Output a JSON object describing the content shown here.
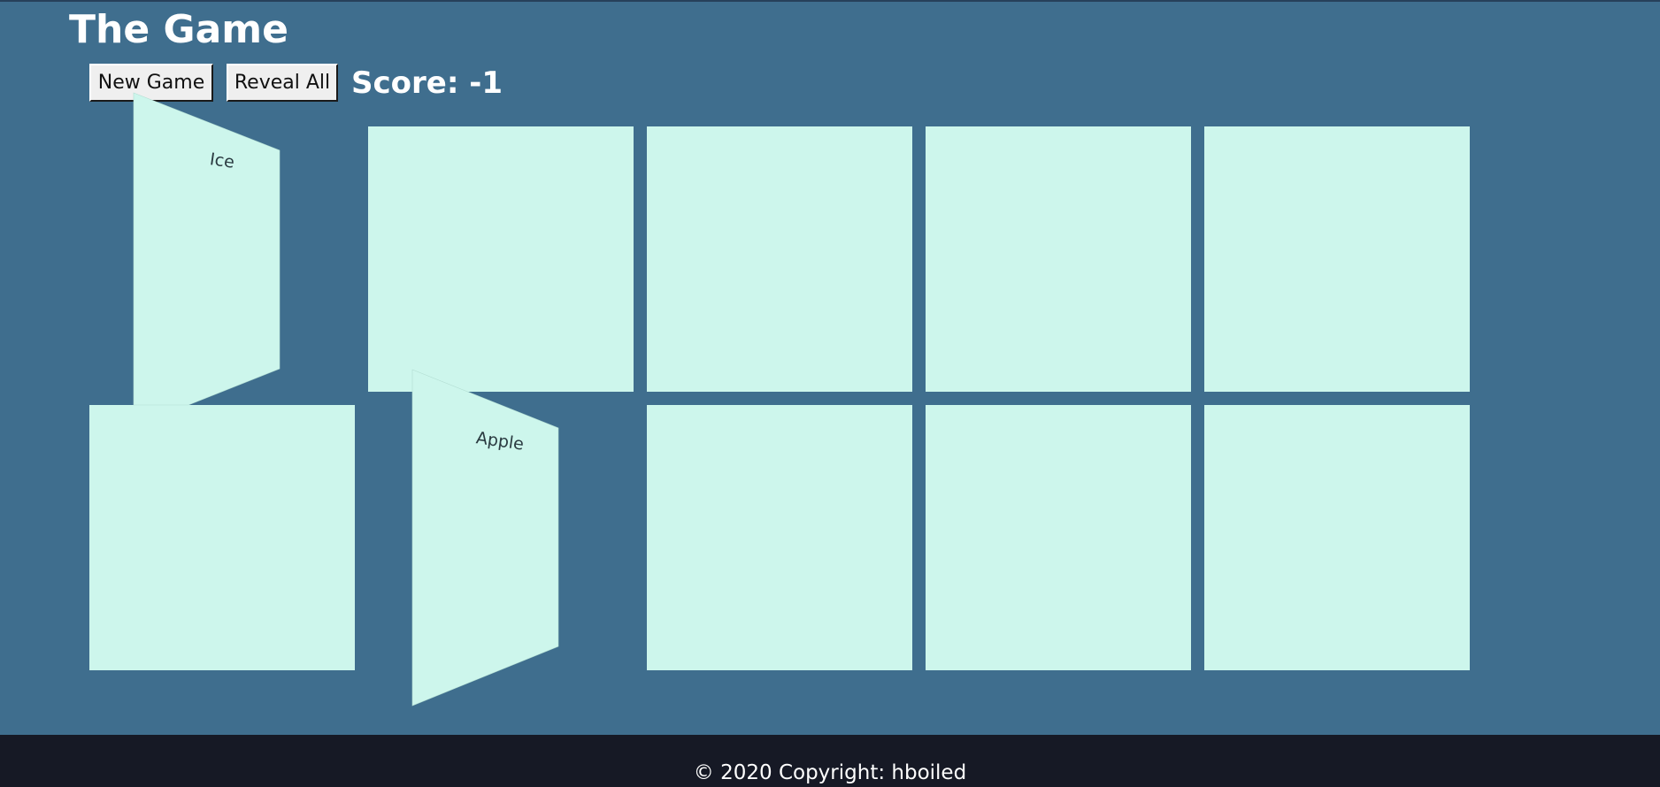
{
  "header": {
    "title": "The Game"
  },
  "controls": {
    "new_game_label": "New Game",
    "reveal_all_label": "Reveal All",
    "score_text": "Score: -1"
  },
  "board": {
    "rows": 2,
    "columns": 5,
    "cards": [
      {
        "row": 0,
        "col": 0,
        "state": "flipping",
        "text": "Ice"
      },
      {
        "row": 0,
        "col": 1,
        "state": "hidden",
        "text": ""
      },
      {
        "row": 0,
        "col": 2,
        "state": "hidden",
        "text": ""
      },
      {
        "row": 0,
        "col": 3,
        "state": "hidden",
        "text": ""
      },
      {
        "row": 0,
        "col": 4,
        "state": "hidden",
        "text": ""
      },
      {
        "row": 1,
        "col": 0,
        "state": "hidden",
        "text": ""
      },
      {
        "row": 1,
        "col": 1,
        "state": "flipping",
        "text": "Apple"
      },
      {
        "row": 1,
        "col": 2,
        "state": "hidden",
        "text": ""
      },
      {
        "row": 1,
        "col": 3,
        "state": "hidden",
        "text": ""
      },
      {
        "row": 1,
        "col": 4,
        "state": "hidden",
        "text": ""
      }
    ]
  },
  "footer": {
    "copyright": "© 2020 Copyright: hboiled"
  },
  "colors": {
    "page_background": "#3f6e8e",
    "card": "#cdf6ec",
    "footer_background": "#161925",
    "text_light": "#ffffff"
  }
}
